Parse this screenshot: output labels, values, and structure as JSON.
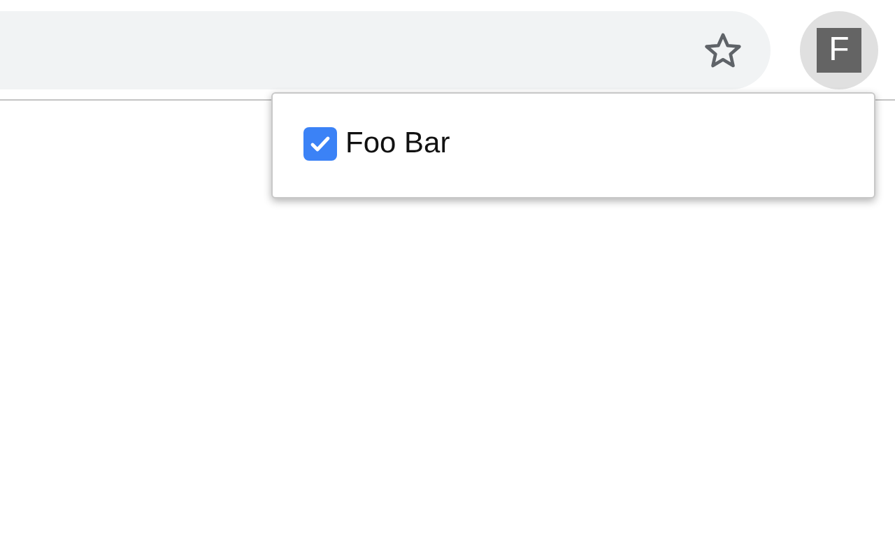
{
  "toolbar": {
    "extension_button": {
      "letter": "F"
    }
  },
  "popup": {
    "items": [
      {
        "label": "Foo Bar",
        "checked": true
      }
    ]
  }
}
